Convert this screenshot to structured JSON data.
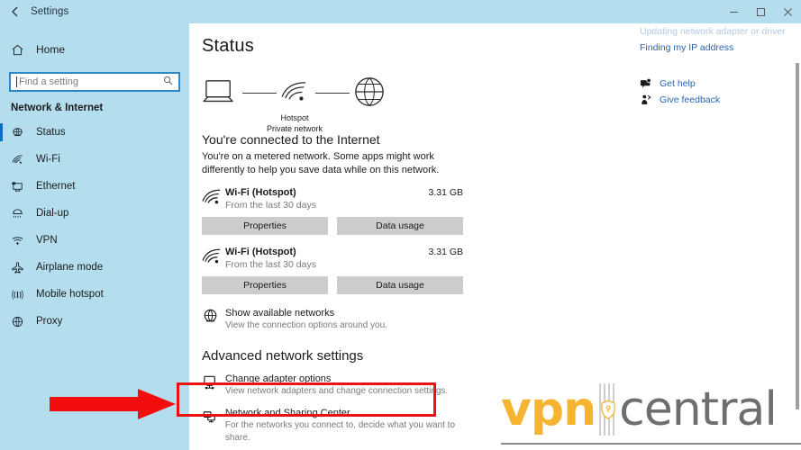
{
  "window": {
    "title": "Settings",
    "back_icon": "back-arrow-icon",
    "minimize": "minimize-icon",
    "maximize": "restore-icon",
    "close": "close-icon"
  },
  "sidebar": {
    "home_label": "Home",
    "home_icon": "home-icon",
    "search": {
      "placeholder": "Find a setting",
      "value": "",
      "icon": "search-icon"
    },
    "category": "Network & Internet",
    "accent_color": "#0b6ec0",
    "background_color": "#b4ddee",
    "items": [
      {
        "label": "Status",
        "icon": "status-globe-icon",
        "selected": true
      },
      {
        "label": "Wi-Fi",
        "icon": "wifi-icon",
        "selected": false
      },
      {
        "label": "Ethernet",
        "icon": "ethernet-icon",
        "selected": false
      },
      {
        "label": "Dial-up",
        "icon": "dialup-icon",
        "selected": false
      },
      {
        "label": "VPN",
        "icon": "vpn-icon",
        "selected": false
      },
      {
        "label": "Airplane mode",
        "icon": "airplane-icon",
        "selected": false
      },
      {
        "label": "Mobile hotspot",
        "icon": "hotspot-icon",
        "selected": false
      },
      {
        "label": "Proxy",
        "icon": "proxy-globe-icon",
        "selected": false
      }
    ]
  },
  "main": {
    "page_title": "Status",
    "diagram": {
      "device_icon": "laptop-icon",
      "middle_icon": "wifi-icon",
      "internet_icon": "globe-icon",
      "caption_line1": "Hotspot",
      "caption_line2": "Private network"
    },
    "connection_heading": "You're connected to the Internet",
    "connection_description": "You're on a metered network. Some apps might work differently to help you save data while on this network.",
    "adapters": [
      {
        "name": "Wi-Fi (Hotspot)",
        "sub": "From the last 30 days",
        "usage": "3.31 GB",
        "icon": "wifi-icon",
        "properties_label": "Properties",
        "data_usage_label": "Data usage"
      },
      {
        "name": "Wi-Fi (Hotspot)",
        "sub": "From the last 30 days",
        "usage": "3.31 GB",
        "icon": "wifi-icon",
        "properties_label": "Properties",
        "data_usage_label": "Data usage"
      }
    ],
    "show_networks": {
      "title": "Show available networks",
      "subtitle": "View the connection options around you.",
      "icon": "globe-icon"
    },
    "advanced_heading": "Advanced network settings",
    "advanced_items": [
      {
        "title": "Change adapter options",
        "subtitle": "View network adapters and change connection settings.",
        "icon": "monitor-network-icon",
        "highlighted": true
      },
      {
        "title": "Network and Sharing Center",
        "subtitle": "For the networks you connect to, decide what you want to share.",
        "icon": "sharing-center-icon",
        "highlighted": false
      }
    ]
  },
  "rail": {
    "cut_link": "Updating network adapter or driver",
    "links": [
      {
        "label": "Finding my IP address"
      }
    ],
    "actions": [
      {
        "label": "Get help",
        "icon": "help-chat-icon"
      },
      {
        "label": "Give feedback",
        "icon": "feedback-person-icon"
      }
    ]
  },
  "annotations": {
    "highlight_color": "#ee1111",
    "arrow_icon": "right-arrow-annotation"
  },
  "watermark": {
    "brand_first": "vpn",
    "brand_second": "central",
    "brand_first_color": "#f5b533",
    "brand_second_color": "#6e6e6e",
    "divider_icon": "shield-icon"
  }
}
